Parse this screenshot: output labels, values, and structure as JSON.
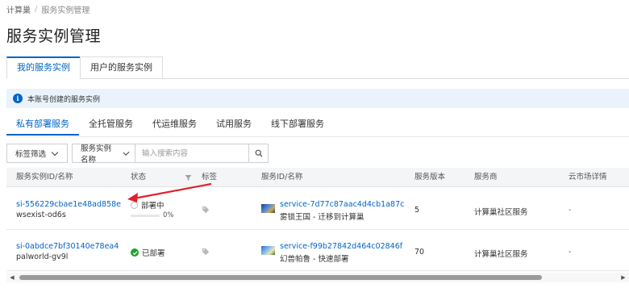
{
  "breadcrumb": {
    "root": "计算巢",
    "separator": "/",
    "current": "服务实例管理"
  },
  "page_title": "服务实例管理",
  "top_tabs": [
    {
      "label": "我的服务实例",
      "active": true
    },
    {
      "label": "用户的服务实例",
      "active": false
    }
  ],
  "info_bar": {
    "icon": "info-icon",
    "text": "本账号创建的服务实例"
  },
  "sub_tabs": [
    {
      "label": "私有部署服务",
      "active": true
    },
    {
      "label": "全托管服务",
      "active": false
    },
    {
      "label": "代运维服务",
      "active": false
    },
    {
      "label": "试用服务",
      "active": false
    },
    {
      "label": "线下部署服务",
      "active": false
    }
  ],
  "filters": {
    "tag_filter_label": "标签筛选",
    "field_select_label": "服务实例名称",
    "search_placeholder": "输入搜索内容"
  },
  "table": {
    "headers": [
      "服务实例ID/名称",
      "状态",
      "标签",
      "服务ID/名称",
      "服务版本",
      "服务商",
      "云市场详情"
    ],
    "rows": [
      {
        "instance_id": "si-556229cbae1e48ad858e",
        "instance_name": "wsexist-od6s",
        "status": "部署中",
        "status_type": "deploying",
        "progress": 0,
        "progress_text": "0%",
        "service_id": "service-7d77c87aac4d4cb1a87c",
        "service_name": "雾锁王国 - 迁移到计算巢",
        "version": "5",
        "provider": "计算巢社区服务",
        "market": "-"
      },
      {
        "instance_id": "si-0abdce7bf30140e78ea4",
        "instance_name": "palworld-gv9l",
        "status": "已部署",
        "status_type": "deployed",
        "service_id": "service-f99b27842d464c02846f",
        "service_name": "幻兽帕鲁 - 快速部署",
        "version": "70",
        "provider": "计算巢社区服务",
        "market": "-"
      }
    ]
  },
  "colors": {
    "accent": "#0064c8",
    "success": "#1fa02f",
    "annotation_arrow": "#e0202a",
    "info_bg": "#eaf3fc"
  }
}
